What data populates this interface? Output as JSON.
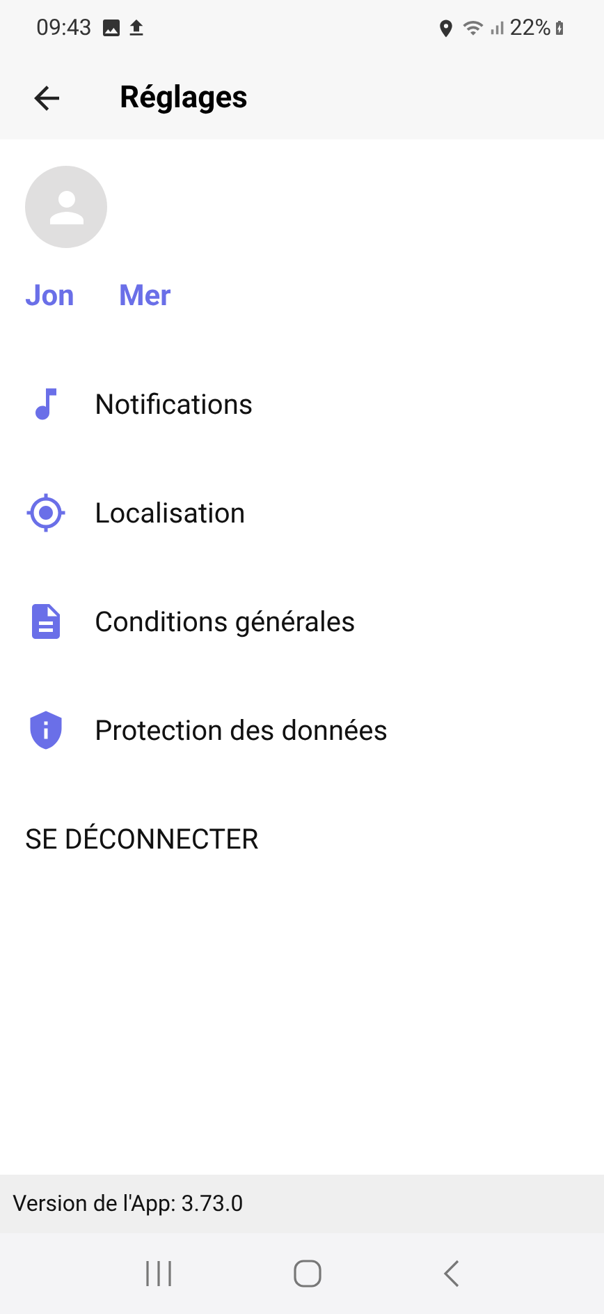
{
  "status_bar": {
    "time": "09:43",
    "battery": "22%"
  },
  "header": {
    "title": "Réglages"
  },
  "profile": {
    "first_name": "Jon",
    "last_name": "Mer"
  },
  "menu": [
    {
      "kind": "notifications",
      "label": "Notifications"
    },
    {
      "kind": "location",
      "label": "Localisation"
    },
    {
      "kind": "terms",
      "label": "Conditions générales"
    },
    {
      "kind": "privacy",
      "label": "Protection des données"
    }
  ],
  "logout": "SE DÉCONNECTER",
  "footer": {
    "version": "Version de l'App: 3.73.0"
  }
}
